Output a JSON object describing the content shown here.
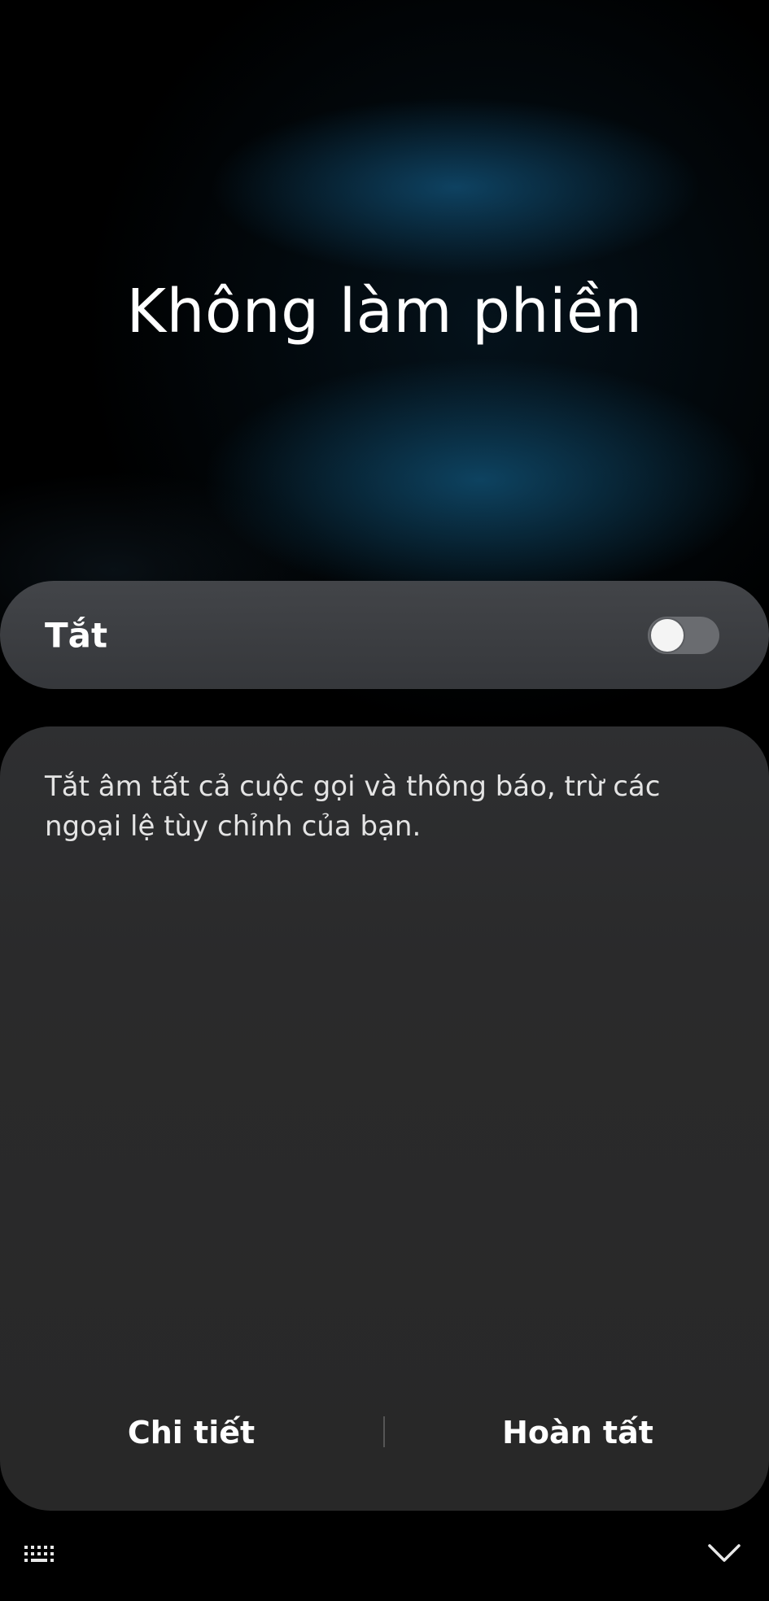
{
  "dialog": {
    "title": "Không làm phiền",
    "toggle": {
      "label": "Tắt",
      "state": "off"
    },
    "description": "Tắt âm tất cả cuộc gọi và thông báo, trừ các ngoại lệ tùy chỉnh của bạn.",
    "buttons": {
      "details_label": "Chi tiết",
      "done_label": "Hoàn tất"
    }
  },
  "nav_bar": {
    "left_icon": "keyboard-icon",
    "right_icon": "chevron-down-icon"
  },
  "colors": {
    "background": "#000000",
    "card": "#48494d",
    "panel": "#2a2a2b",
    "text": "#ffffff",
    "switch_track": "#6a6c70",
    "switch_knob": "#f4f4f4"
  }
}
